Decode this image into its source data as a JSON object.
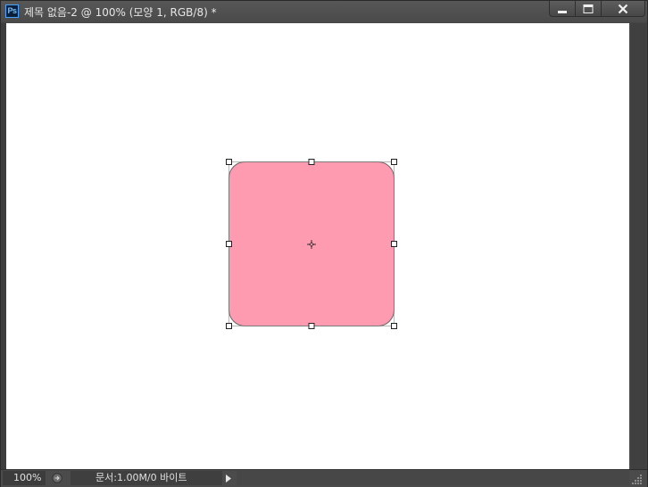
{
  "window": {
    "app_icon_text": "Ps",
    "title": "제목 없음-2 @ 100% (모양 1, RGB/8) *"
  },
  "shape": {
    "fill_color": "#ff9bb0",
    "handle_color": "#ffffff"
  },
  "statusbar": {
    "zoom": "100%",
    "doc_info": "문서:1.00M/0 바이트"
  },
  "icons": [
    "photoshop-app-icon",
    "minimize-icon",
    "maximize-icon",
    "close-icon",
    "export-icon",
    "status-menu-arrow-icon",
    "resize-grip-icon",
    "center-crosshair-icon"
  ]
}
